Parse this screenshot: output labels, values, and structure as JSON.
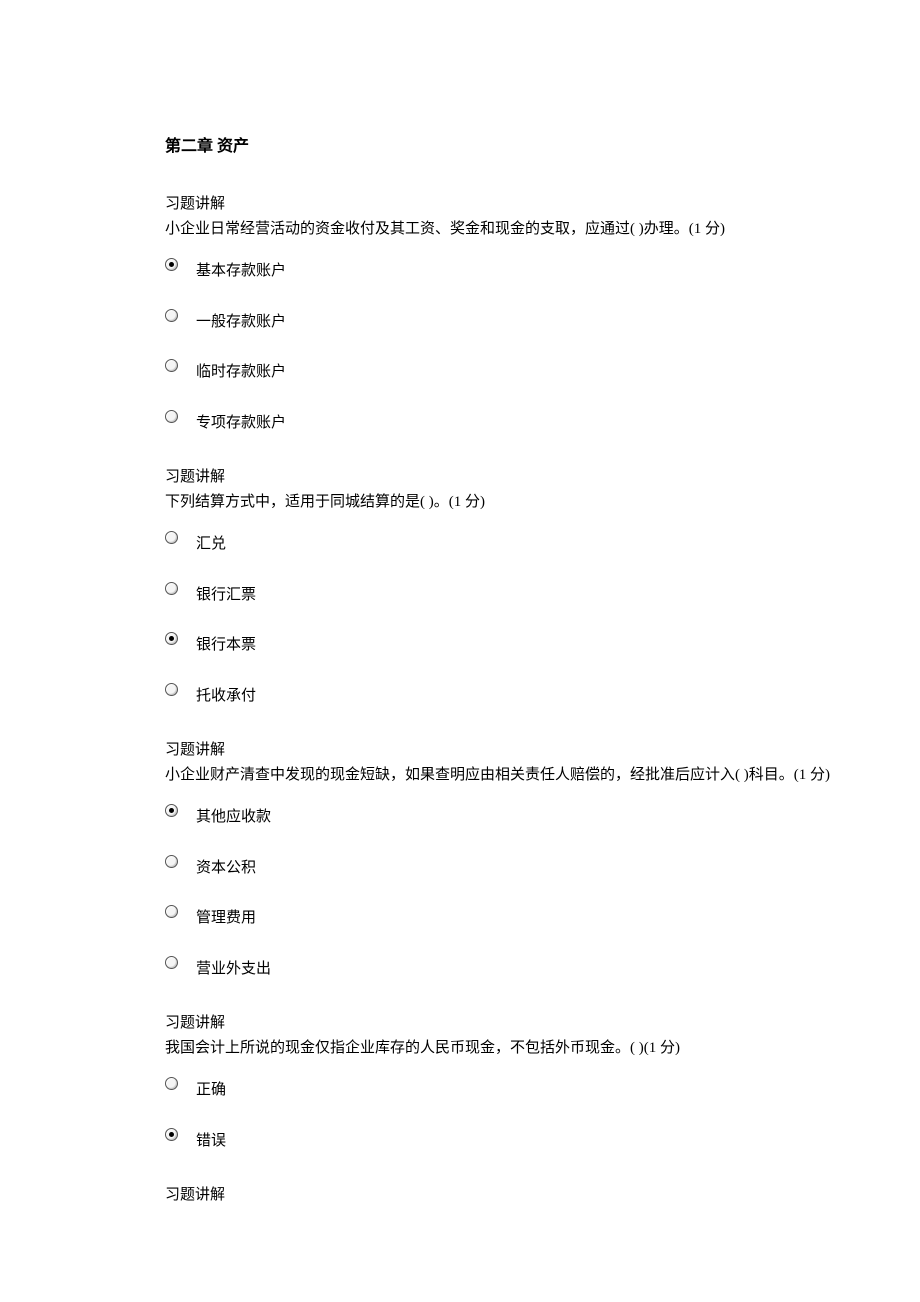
{
  "title": "第二章 资产",
  "questions": [
    {
      "section": "习题讲解",
      "text": "小企业日常经营活动的资金收付及其工资、奖金和现金的支取，应通过( )办理。(1 分)",
      "options": [
        "基本存款账户",
        "一般存款账户",
        "临时存款账户",
        "专项存款账户"
      ],
      "selected": 0
    },
    {
      "section": "习题讲解",
      "text": "下列结算方式中，适用于同城结算的是( )。(1 分)",
      "options": [
        "汇兑",
        "银行汇票",
        "银行本票",
        "托收承付"
      ],
      "selected": 2
    },
    {
      "section": "习题讲解",
      "text": "小企业财产清查中发现的现金短缺，如果查明应由相关责任人赔偿的，经批准后应计入( )科目。(1 分)",
      "options": [
        "其他应收款",
        "资本公积",
        "管理费用",
        "营业外支出"
      ],
      "selected": 0
    },
    {
      "section": "习题讲解",
      "text": "我国会计上所说的现金仅指企业库存的人民币现金，不包括外币现金。( )(1 分)",
      "options": [
        "正确",
        "错误"
      ],
      "selected": 1
    },
    {
      "section": "习题讲解",
      "text": "",
      "options": [],
      "selected": -1
    }
  ]
}
